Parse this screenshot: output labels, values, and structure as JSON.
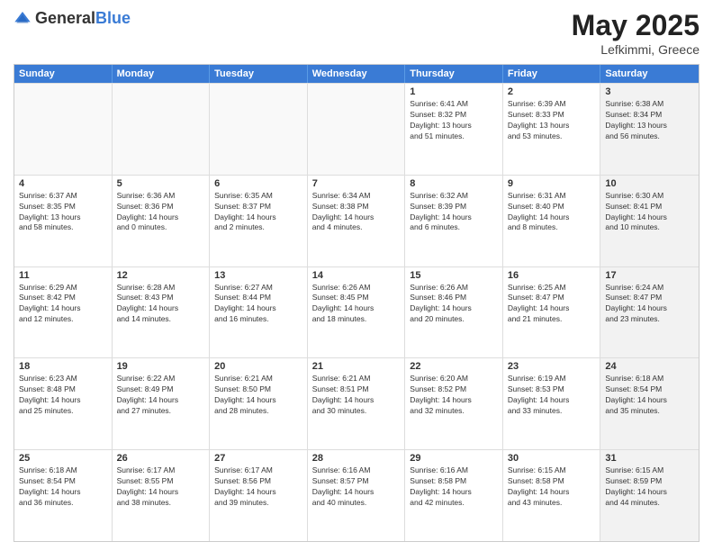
{
  "header": {
    "logo_general": "General",
    "logo_blue": "Blue",
    "month_year": "May 2025",
    "location": "Lefkimmi, Greece"
  },
  "calendar": {
    "days_of_week": [
      "Sunday",
      "Monday",
      "Tuesday",
      "Wednesday",
      "Thursday",
      "Friday",
      "Saturday"
    ],
    "rows": [
      [
        {
          "day": "",
          "text": "",
          "empty": true
        },
        {
          "day": "",
          "text": "",
          "empty": true
        },
        {
          "day": "",
          "text": "",
          "empty": true
        },
        {
          "day": "",
          "text": "",
          "empty": true
        },
        {
          "day": "1",
          "text": "Sunrise: 6:41 AM\nSunset: 8:32 PM\nDaylight: 13 hours\nand 51 minutes."
        },
        {
          "day": "2",
          "text": "Sunrise: 6:39 AM\nSunset: 8:33 PM\nDaylight: 13 hours\nand 53 minutes."
        },
        {
          "day": "3",
          "text": "Sunrise: 6:38 AM\nSunset: 8:34 PM\nDaylight: 13 hours\nand 56 minutes.",
          "shaded": true
        }
      ],
      [
        {
          "day": "4",
          "text": "Sunrise: 6:37 AM\nSunset: 8:35 PM\nDaylight: 13 hours\nand 58 minutes."
        },
        {
          "day": "5",
          "text": "Sunrise: 6:36 AM\nSunset: 8:36 PM\nDaylight: 14 hours\nand 0 minutes."
        },
        {
          "day": "6",
          "text": "Sunrise: 6:35 AM\nSunset: 8:37 PM\nDaylight: 14 hours\nand 2 minutes."
        },
        {
          "day": "7",
          "text": "Sunrise: 6:34 AM\nSunset: 8:38 PM\nDaylight: 14 hours\nand 4 minutes."
        },
        {
          "day": "8",
          "text": "Sunrise: 6:32 AM\nSunset: 8:39 PM\nDaylight: 14 hours\nand 6 minutes."
        },
        {
          "day": "9",
          "text": "Sunrise: 6:31 AM\nSunset: 8:40 PM\nDaylight: 14 hours\nand 8 minutes."
        },
        {
          "day": "10",
          "text": "Sunrise: 6:30 AM\nSunset: 8:41 PM\nDaylight: 14 hours\nand 10 minutes.",
          "shaded": true
        }
      ],
      [
        {
          "day": "11",
          "text": "Sunrise: 6:29 AM\nSunset: 8:42 PM\nDaylight: 14 hours\nand 12 minutes."
        },
        {
          "day": "12",
          "text": "Sunrise: 6:28 AM\nSunset: 8:43 PM\nDaylight: 14 hours\nand 14 minutes."
        },
        {
          "day": "13",
          "text": "Sunrise: 6:27 AM\nSunset: 8:44 PM\nDaylight: 14 hours\nand 16 minutes."
        },
        {
          "day": "14",
          "text": "Sunrise: 6:26 AM\nSunset: 8:45 PM\nDaylight: 14 hours\nand 18 minutes."
        },
        {
          "day": "15",
          "text": "Sunrise: 6:26 AM\nSunset: 8:46 PM\nDaylight: 14 hours\nand 20 minutes."
        },
        {
          "day": "16",
          "text": "Sunrise: 6:25 AM\nSunset: 8:47 PM\nDaylight: 14 hours\nand 21 minutes."
        },
        {
          "day": "17",
          "text": "Sunrise: 6:24 AM\nSunset: 8:47 PM\nDaylight: 14 hours\nand 23 minutes.",
          "shaded": true
        }
      ],
      [
        {
          "day": "18",
          "text": "Sunrise: 6:23 AM\nSunset: 8:48 PM\nDaylight: 14 hours\nand 25 minutes."
        },
        {
          "day": "19",
          "text": "Sunrise: 6:22 AM\nSunset: 8:49 PM\nDaylight: 14 hours\nand 27 minutes."
        },
        {
          "day": "20",
          "text": "Sunrise: 6:21 AM\nSunset: 8:50 PM\nDaylight: 14 hours\nand 28 minutes."
        },
        {
          "day": "21",
          "text": "Sunrise: 6:21 AM\nSunset: 8:51 PM\nDaylight: 14 hours\nand 30 minutes."
        },
        {
          "day": "22",
          "text": "Sunrise: 6:20 AM\nSunset: 8:52 PM\nDaylight: 14 hours\nand 32 minutes."
        },
        {
          "day": "23",
          "text": "Sunrise: 6:19 AM\nSunset: 8:53 PM\nDaylight: 14 hours\nand 33 minutes."
        },
        {
          "day": "24",
          "text": "Sunrise: 6:18 AM\nSunset: 8:54 PM\nDaylight: 14 hours\nand 35 minutes.",
          "shaded": true
        }
      ],
      [
        {
          "day": "25",
          "text": "Sunrise: 6:18 AM\nSunset: 8:54 PM\nDaylight: 14 hours\nand 36 minutes."
        },
        {
          "day": "26",
          "text": "Sunrise: 6:17 AM\nSunset: 8:55 PM\nDaylight: 14 hours\nand 38 minutes."
        },
        {
          "day": "27",
          "text": "Sunrise: 6:17 AM\nSunset: 8:56 PM\nDaylight: 14 hours\nand 39 minutes."
        },
        {
          "day": "28",
          "text": "Sunrise: 6:16 AM\nSunset: 8:57 PM\nDaylight: 14 hours\nand 40 minutes."
        },
        {
          "day": "29",
          "text": "Sunrise: 6:16 AM\nSunset: 8:58 PM\nDaylight: 14 hours\nand 42 minutes."
        },
        {
          "day": "30",
          "text": "Sunrise: 6:15 AM\nSunset: 8:58 PM\nDaylight: 14 hours\nand 43 minutes."
        },
        {
          "day": "31",
          "text": "Sunrise: 6:15 AM\nSunset: 8:59 PM\nDaylight: 14 hours\nand 44 minutes.",
          "shaded": true
        }
      ]
    ]
  }
}
